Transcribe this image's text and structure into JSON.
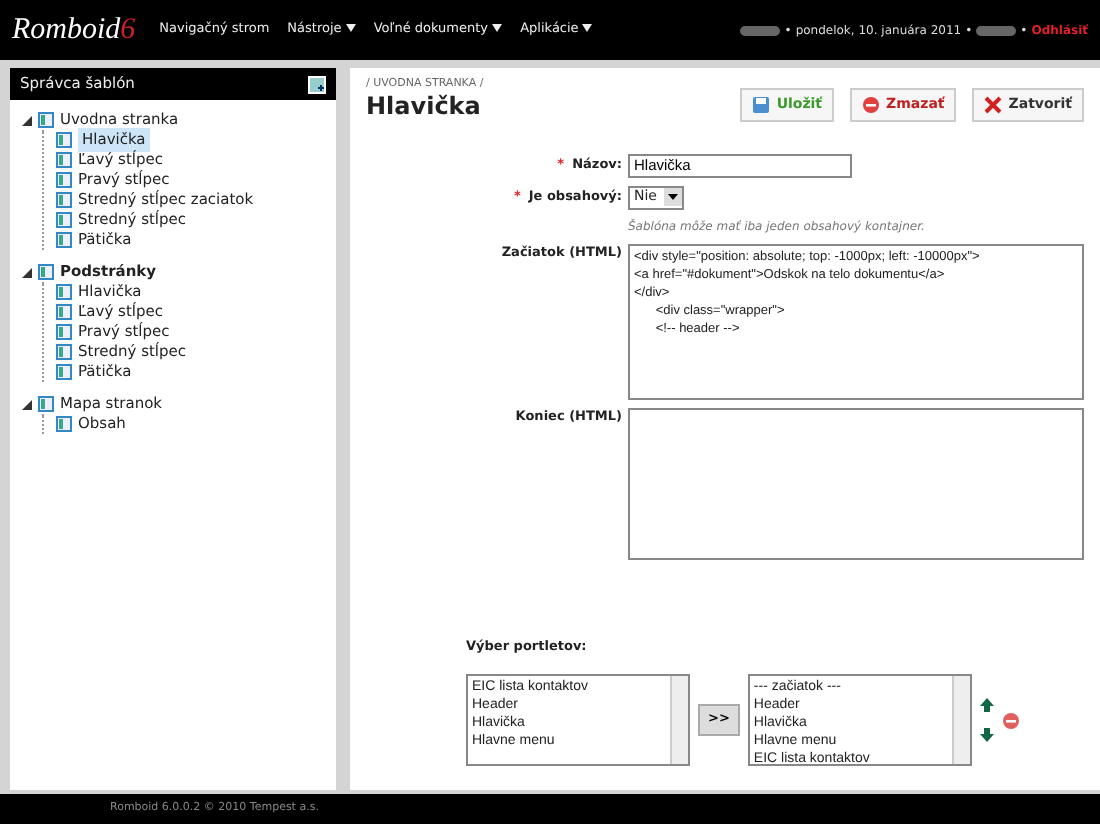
{
  "topbar": {
    "logo": "Romboid",
    "logo_version": "6",
    "menu": [
      {
        "label": "Navigačný strom",
        "dropdown": false
      },
      {
        "label": "Nástroje",
        "dropdown": true
      },
      {
        "label": "Voľné dokumenty",
        "dropdown": true
      },
      {
        "label": "Aplikácie",
        "dropdown": true
      }
    ],
    "status": [
      {
        "kind": "redacted"
      },
      {
        "kind": "separator",
        "text": "•"
      },
      {
        "kind": "date",
        "text": "pondelok, 10. januára 2011"
      },
      {
        "kind": "separator",
        "text": "•"
      },
      {
        "kind": "redacted"
      },
      {
        "kind": "separator",
        "text": "•"
      },
      {
        "kind": "logout",
        "text": "Odhlásiť"
      }
    ]
  },
  "sidebar": {
    "title": "Správca šablón",
    "tree": [
      {
        "label": "Uvodna stranka",
        "bold": false,
        "expanded": true,
        "selected": false,
        "children": [
          {
            "label": "Hlavička",
            "selected": true
          },
          {
            "label": "Ľavý stĺpec",
            "selected": false
          },
          {
            "label": "Pravý stĺpec",
            "selected": false
          },
          {
            "label": "Stredný stĺpec zaciatok",
            "selected": false
          },
          {
            "label": "Stredný stĺpec",
            "selected": false
          },
          {
            "label": "Pätička",
            "selected": false
          }
        ]
      },
      {
        "label": "Podstránky",
        "bold": true,
        "expanded": true,
        "selected": false,
        "children": [
          {
            "label": "Hlavička",
            "selected": false
          },
          {
            "label": "Ľavý stĺpec",
            "selected": false
          },
          {
            "label": "Pravý stĺpec",
            "selected": false
          },
          {
            "label": "Stredný stĺpec",
            "selected": false
          },
          {
            "label": "Pätička",
            "selected": false
          }
        ]
      },
      {
        "label": "Mapa stranok",
        "bold": false,
        "expanded": true,
        "selected": false,
        "children": [
          {
            "label": "Obsah",
            "selected": false
          }
        ]
      }
    ]
  },
  "main": {
    "breadcrumb": "/ UVODNA STRANKA /",
    "title": "Hlavička",
    "buttons": [
      {
        "kind": "save",
        "label": "Uložiť"
      },
      {
        "kind": "delete",
        "label": "Zmazať"
      },
      {
        "kind": "close",
        "label": "Zatvoriť"
      }
    ],
    "form": {
      "name_required": "*",
      "name_label": "Názov:",
      "name_value": "Hlavička",
      "content_required": "*",
      "content_label": "Je obsahový:",
      "content_value": "Nie",
      "hint": "Šablóna môže mať iba jeden obsahový kontajner.",
      "start_label": "Začiatok (HTML)",
      "start_lines": [
        "<div style=\"position: absolute; top: -1000px; left: -10000px\">",
        "<a href=\"#dokument\">Odskok na telo dokumentu</a>",
        "</div>",
        "      <div class=\"wrapper\">",
        "      <!-- header -->"
      ],
      "end_label": "Koniec (HTML)"
    },
    "portlets": {
      "label": "Výber portletov:",
      "available": [
        "EIC lista kontaktov",
        "Header",
        "Hlavička",
        "Hlavne menu"
      ],
      "add_button": ">>",
      "chosen": [
        "--- začiatok ---",
        "Header",
        "Hlavička",
        "Hlavne menu",
        "EIC lista kontaktov"
      ]
    }
  },
  "footer": "Romboid 6.0.0.2 © 2010 Tempest a.s."
}
